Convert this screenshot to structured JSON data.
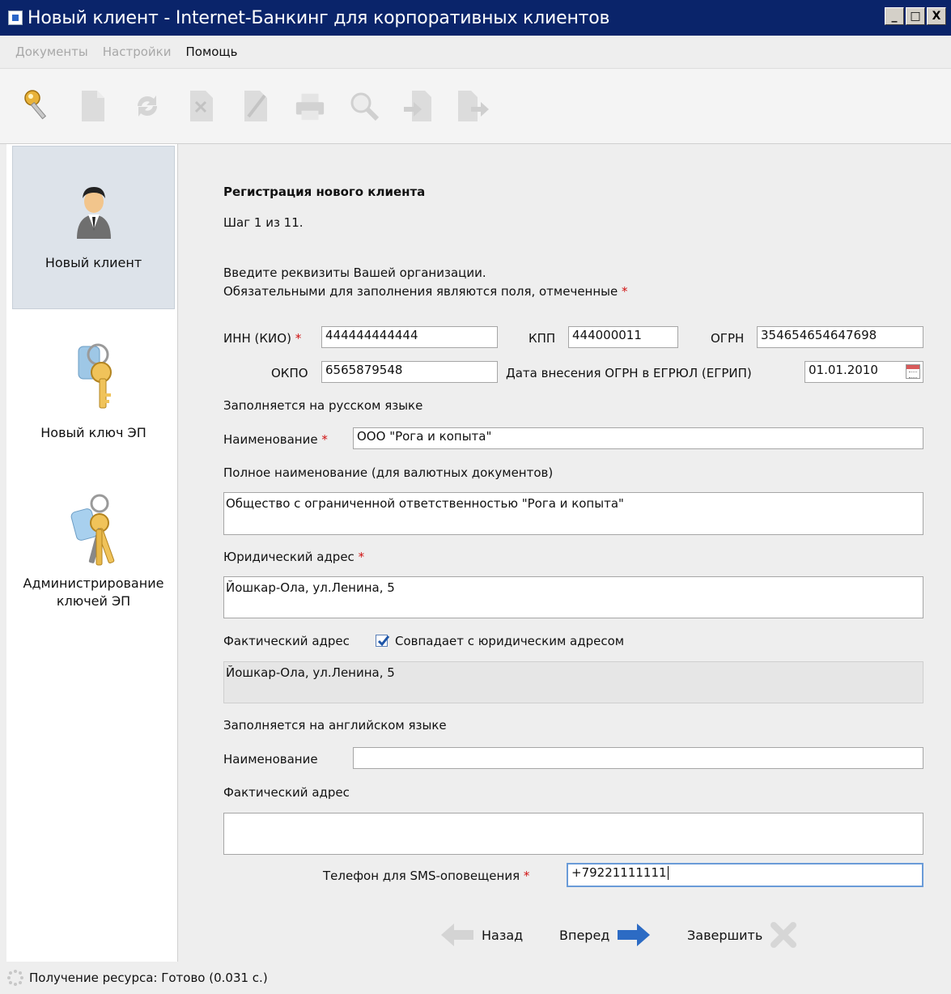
{
  "window": {
    "title": "Новый клиент - Internet-Банкинг для корпоративных клиентов",
    "minimize": "_",
    "maximize": "□",
    "close": "X"
  },
  "menu": {
    "documents": "Документы",
    "settings": "Настройки",
    "help": "Помощь"
  },
  "toolbar": {
    "icons": [
      "key-icon",
      "new-document-icon",
      "refresh-icon",
      "delete-document-icon",
      "edit-document-icon",
      "print-icon",
      "search-icon",
      "import-icon",
      "export-icon"
    ]
  },
  "sidebar": {
    "items": [
      {
        "label": "Новый клиент",
        "icon": "user-icon",
        "active": true
      },
      {
        "label": "Новый ключ ЭП",
        "icon": "key-icon",
        "active": false
      },
      {
        "label_line1": "Администрирование",
        "label_line2": "ключей ЭП",
        "icon": "keys-bunch-icon",
        "active": false
      }
    ]
  },
  "form": {
    "heading": "Регистрация нового клиента",
    "step": "Шаг 1 из 11.",
    "intro_line1": "Введите реквизиты Вашей организации.",
    "intro_line2": "Обязательными для заполнения являются поля, отмеченные",
    "required_mark": "*",
    "inn_label": "ИНН (КИО)",
    "inn_value": "444444444444",
    "kpp_label": "КПП",
    "kpp_value": "444000011",
    "ogrn_label": "ОГРН",
    "ogrn_value": "354654654647698",
    "okpo_label": "ОКПО",
    "okpo_value": "6565879548",
    "ogrn_date_label": "Дата внесения ОГРН в ЕГРЮЛ (ЕГРИП)",
    "ogrn_date_value": "01.01.2010",
    "ru_section": "Заполняется на русском языке",
    "name_label": "Наименование",
    "name_value": "ООО \"Рога и копыта\"",
    "full_name_label": "Полное наименование (для валютных документов)",
    "full_name_value": "Общество с ограниченной ответственностью \"Рога и копыта\"",
    "legal_address_label": "Юридический адрес",
    "legal_address_value": "Йошкар-Ола, ул.Ленина, 5",
    "actual_address_label": "Фактический адрес",
    "same_address_label": "Совпадает с юридическим адресом",
    "same_address_checked": true,
    "actual_address_value": "Йошкар-Ола, ул.Ленина, 5",
    "en_section": "Заполняется на английском языке",
    "en_name_label": "Наименование",
    "en_name_value": "",
    "en_address_label": "Фактический адрес",
    "en_address_value": "",
    "sms_phone_label": "Телефон для SMS-оповещения",
    "sms_phone_value": "+79221111111"
  },
  "buttons": {
    "back": "Назад",
    "next": "Вперед",
    "finish": "Завершить"
  },
  "status": {
    "text": "Получение ресурса: Готово (0.031 с.)"
  },
  "colors": {
    "title_bar": "#0a246a",
    "required": "#d01010",
    "active_nav": "#dde3ea",
    "next_arrow": "#2c6bc4"
  }
}
